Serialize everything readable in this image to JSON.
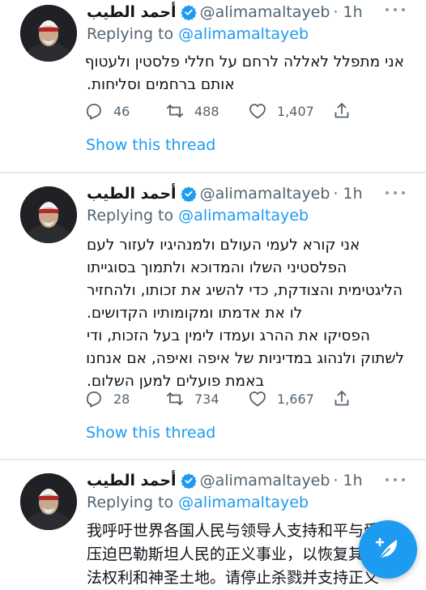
{
  "tweets": [
    {
      "author_name": "أحمد الطيب",
      "handle": "@alimamaltayeb",
      "time": "· 1h",
      "replying_prefix": "Replying to",
      "replying_to": "@alimamaltayeb",
      "lines": [
        "אני מתפלל לאללה לרחם על חללי פלסטין ולעטוף",
        "אותם ברחמים וסליחות."
      ],
      "reply_count": "46",
      "retweet_count": "488",
      "like_count": "1,407",
      "show_thread": "Show this thread"
    },
    {
      "author_name": "أحمد الطيب",
      "handle": "@alimamaltayeb",
      "time": "· 1h",
      "replying_prefix": "Replying to",
      "replying_to": "@alimamaltayeb",
      "lines": [
        "אני קורא לעמי העולם ולמנהיגיו לעזור לעם",
        "הפלסטיני השלו והמדוכא ולתמוך בסוגייתו",
        "הליגטימית והצודקת, כדי להשיג את זכותו, ולהחזיר",
        "לו את אדמתו ומקומותיו הקדושים.",
        "הפסיקו את ההרג ועמדו לימין בעל הזכות, ודי",
        "לשתוק ולנהוג במדיניות של איפה ואיפה, אם אנחנו",
        "באמת פועלים למען השלום."
      ],
      "reply_count": "28",
      "retweet_count": "734",
      "like_count": "1,667",
      "show_thread": "Show this thread"
    },
    {
      "author_name": "أحمد الطيب",
      "handle": "@alimamaltayeb",
      "time": "· 1h",
      "replying_prefix": "Replying to",
      "replying_to": "@alimamaltayeb",
      "lines": [
        "我呼吁世界各国人民与领导人支持和平与受",
        "压迫巴勒斯坦人民的正义事业，以恢复其合",
        "法权利和神圣土地。请停止杀戮并支持正义"
      ]
    }
  ],
  "icons": {
    "verified": "verified-badge-icon",
    "reply": "reply-icon",
    "retweet": "retweet-icon",
    "like": "heart-icon",
    "share": "share-icon",
    "more": "more-dots-icon",
    "compose": "compose-feather-icon"
  },
  "colors": {
    "accent": "#1d9bf0",
    "secondary_text": "#536471",
    "divider": "#e6ecf0"
  }
}
